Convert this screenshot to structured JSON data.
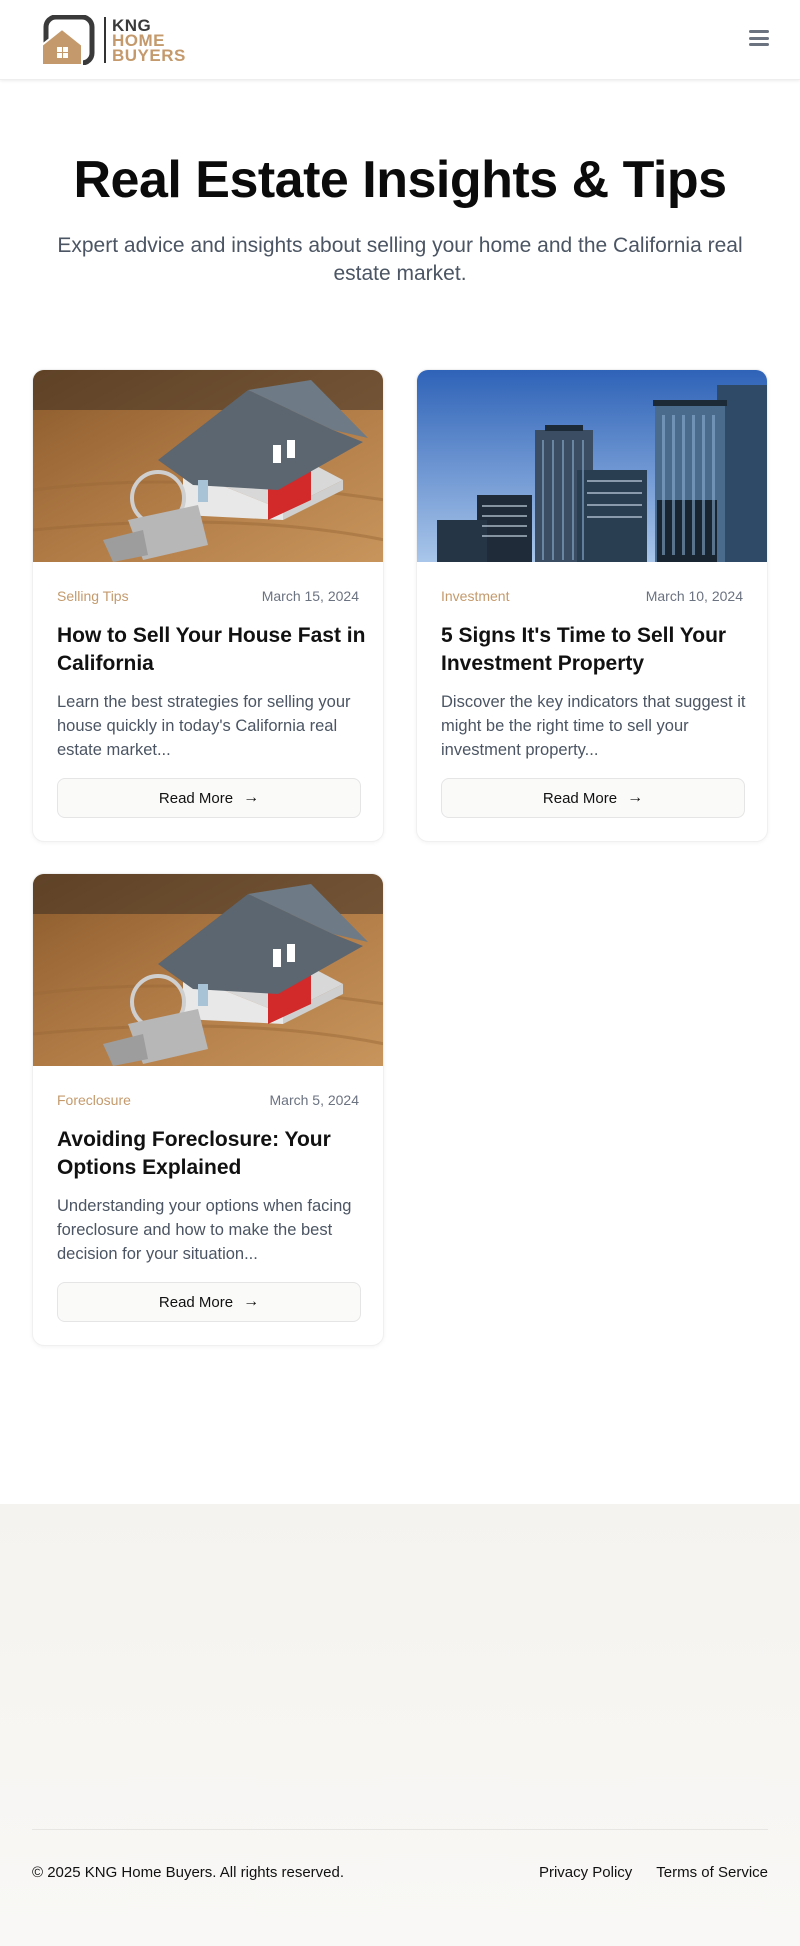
{
  "header": {
    "logo_line1": "KNG",
    "logo_line2": "HOME",
    "logo_line3": "BUYERS",
    "menu_icon": "hamburger-menu-icon"
  },
  "hero": {
    "title": "Real Estate Insights & Tips",
    "subtitle": "Expert advice and insights about selling your home and the California real estate market."
  },
  "posts": [
    {
      "category": "Selling Tips",
      "date": "March 15, 2024",
      "title": "How to Sell Your House Fast in California",
      "excerpt": "Learn the best strategies for selling your house quickly in today's California real estate market...",
      "button": "Read More",
      "image": "house-model-with-keys"
    },
    {
      "category": "Investment",
      "date": "March 10, 2024",
      "title": "5 Signs It's Time to Sell Your Investment Property",
      "excerpt": "Discover the key indicators that suggest it might be the right time to sell your investment property...",
      "button": "Read More",
      "image": "city-skyscrapers"
    },
    {
      "category": "Foreclosure",
      "date": "March 5, 2024",
      "title": "Avoiding Foreclosure: Your Options Explained",
      "excerpt": "Understanding your options when facing foreclosure and how to make the best decision for your situation...",
      "button": "Read More",
      "image": "house-model-with-keys"
    }
  ],
  "footer": {
    "copyright": "© 2025 KNG Home Buyers. All rights reserved.",
    "links": [
      "Privacy Policy",
      "Terms of Service"
    ]
  },
  "colors": {
    "accent": "#c49a6c",
    "logo_dark": "#3a3a3a",
    "footer_bg": "#f6f4f0"
  }
}
